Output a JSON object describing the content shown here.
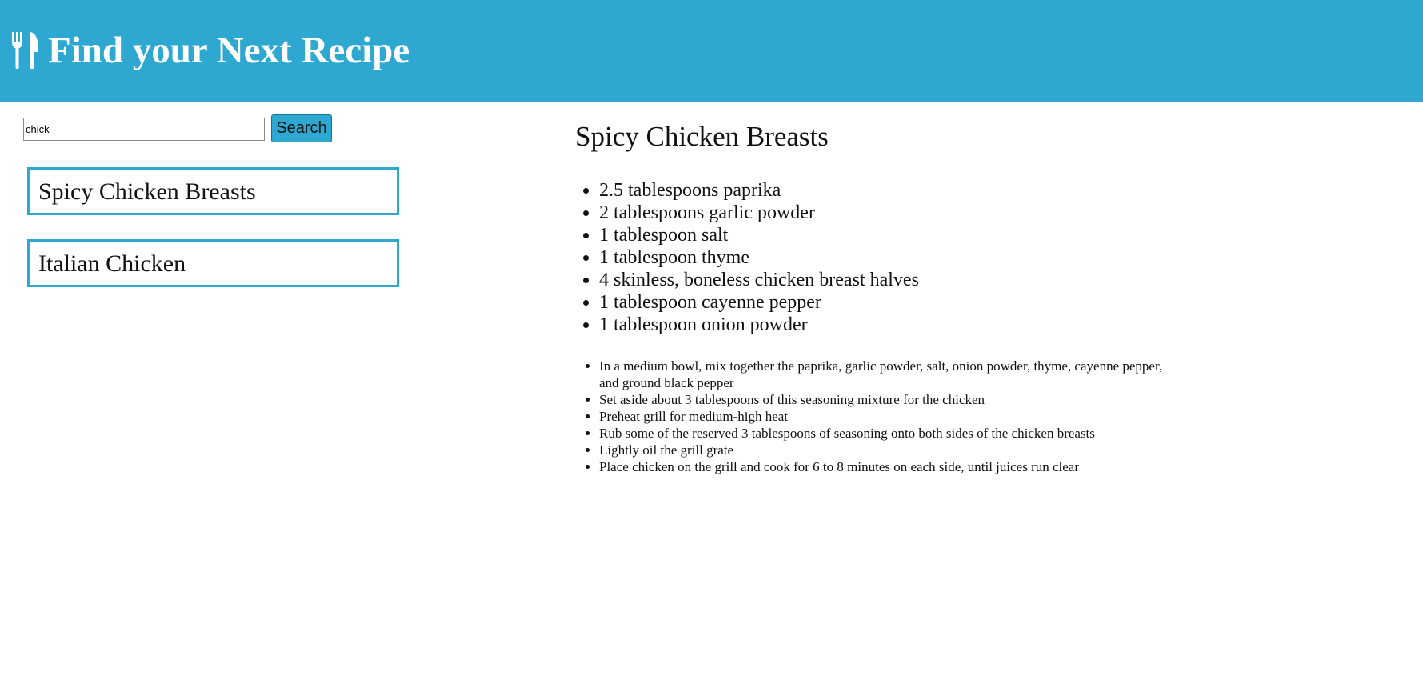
{
  "header": {
    "title": "Find your Next Recipe",
    "icon": "utensils-icon",
    "background_color": "#2ea8d1"
  },
  "search": {
    "value": "chick",
    "button_label": "Search"
  },
  "results": [
    {
      "title": "Spicy Chicken Breasts"
    },
    {
      "title": "Italian Chicken"
    }
  ],
  "recipe": {
    "title": "Spicy Chicken Breasts",
    "ingredients": [
      "2.5 tablespoons paprika",
      "2 tablespoons garlic powder",
      "1 tablespoon salt",
      "1 tablespoon thyme",
      "4 skinless, boneless chicken breast halves",
      "1 tablespoon cayenne pepper",
      "1 tablespoon onion powder"
    ],
    "steps": [
      "In a medium bowl, mix together the paprika, garlic powder, salt, onion powder, thyme, cayenne pepper, and ground black pepper",
      "Set aside about 3 tablespoons of this seasoning mixture for the chicken",
      "Preheat grill for medium-high heat",
      "Rub some of the reserved 3 tablespoons of seasoning onto both sides of the chicken breasts",
      "Lightly oil the grill grate",
      "Place chicken on the grill and cook for 6 to 8 minutes on each side, until juices run clear"
    ]
  }
}
